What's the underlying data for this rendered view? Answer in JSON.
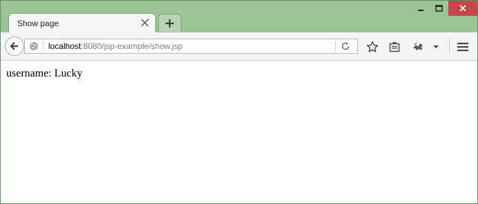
{
  "tab": {
    "title": "Show page"
  },
  "address": {
    "host": "localhost",
    "rest": ":8080/jsp-example/show.jsp"
  },
  "page": {
    "label": "username:",
    "value": "Lucky"
  },
  "icons": {
    "back": "arrow-left-icon",
    "site": "globe-icon",
    "reload": "reload-icon",
    "bookmark": "star-icon",
    "reading": "reading-list-icon",
    "extension": "extension-icon",
    "menu": "hamburger-menu-icon"
  },
  "colors": {
    "titlebar": "#9dc497",
    "close_button": "#c7474a",
    "tab": "#f7f7f7",
    "navbar": "#f4f4f4"
  }
}
